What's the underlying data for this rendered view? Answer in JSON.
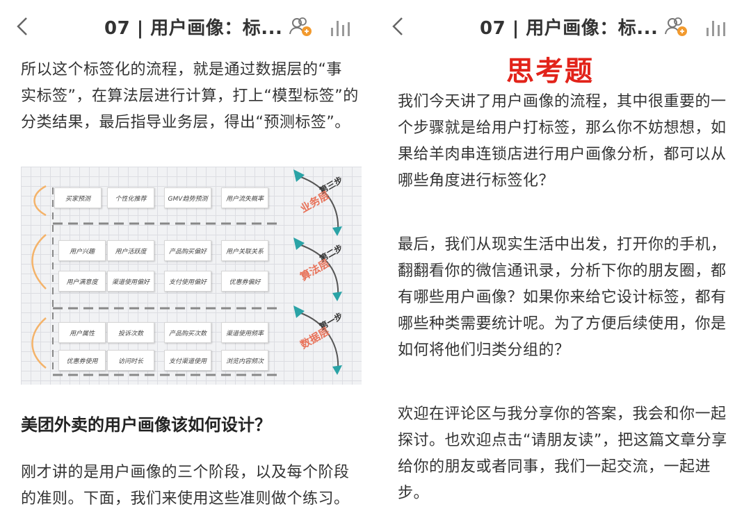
{
  "left": {
    "header": {
      "title": "07 | 用户画像：标...",
      "back_icon": "chevron-left-icon",
      "listen_icon": "listen-users-icon",
      "stats_icon": "bar-chart-icon"
    },
    "intro_lines": [
      "所以这个标签化的流程，就是通过数据层的“事",
      "实标签”，在算法层进行计算，打上“模型标签”的",
      "分类结果，最后指导业务层，得出“预测标签”。"
    ],
    "diagram": {
      "stages": [
        {
          "name": "第三步",
          "layer": "业务层",
          "tags": [
            "买家预测",
            "个性化推荐",
            "GMV趋势预测",
            "用户流失概率"
          ]
        },
        {
          "name": "第二步",
          "layer": "算法层",
          "tags": [
            "用户兴趣",
            "用户活跃度",
            "产品购买偏好",
            "用户关联关系",
            "用户满意度",
            "渠道使用偏好",
            "支付使用偏好",
            "优惠券偏好"
          ]
        },
        {
          "name": "第一步",
          "layer": "数据层",
          "tags": [
            "用户属性",
            "投诉次数",
            "产品购买次数",
            "渠道使用频率",
            "优惠券使用",
            "访问时长",
            "支付渠道使用",
            "浏览内容频次"
          ]
        }
      ]
    },
    "section_heading": "美团外卖的用户画像该如何设计？",
    "section_lines": [
      "刚才讲的是用户画像的三个阶段，以及每个阶段",
      "的准则。下面，我们来使用这些准则做个练习。"
    ]
  },
  "right": {
    "header": {
      "title": "07 | 用户画像：标...",
      "back_icon": "chevron-left-icon",
      "listen_icon": "listen-users-icon",
      "stats_icon": "bar-chart-icon"
    },
    "heading": "思考题",
    "para1_lines": [
      "我们今天讲了用户画像的流程，其中很重要的一",
      "个步骤就是给用户打标签，那么你不妨想想，如",
      "果给羊肉串连锁店进行用户画像分析，都可以从",
      "哪些角度进行标签化？"
    ],
    "para2_lines": [
      "最后，我们从现实生活中出发，打开你的手机，",
      "翻翻看你的微信通讯录，分析下你的朋友圈，都",
      "有哪些用户画像？如果你来给它设计标签，都有",
      "哪些种类需要统计呢。为了方便后续使用，你是",
      "如何将他们归类分组的？"
    ],
    "para3_lines": [
      "欢迎在评论区与我分享你的答案，我会和你一起",
      "探讨。也欢迎点击“请朋友读”，把这篇文章分享",
      "给你的朋友或者同事，我们一起交流，一起进",
      "步。"
    ]
  },
  "colors": {
    "accent_red": "#e2231a",
    "badge_orange": "#f29a2e",
    "arrow_teal": "#2aa3a6",
    "diagram_orange": "#e8735a"
  }
}
